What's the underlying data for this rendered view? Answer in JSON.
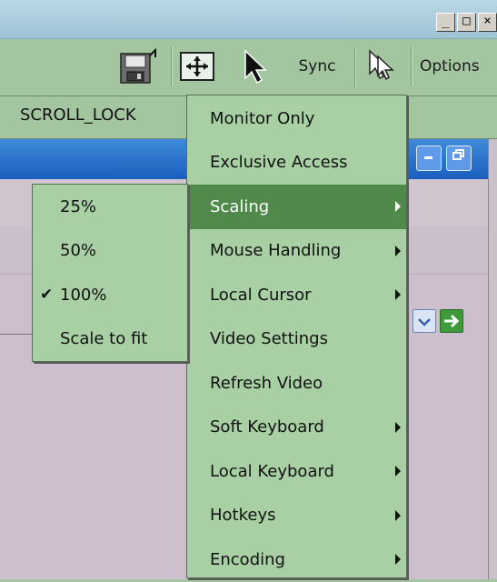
{
  "window": {
    "minimize_label": "_",
    "maximize_label": "□",
    "close_label": "×"
  },
  "toolbar": {
    "sync_label": "Sync",
    "options_label": "Options"
  },
  "status": {
    "scroll_lock": "SCROLL_LOCK"
  },
  "menu": {
    "items": [
      {
        "label": "Monitor Only",
        "has_submenu": false
      },
      {
        "label": "Exclusive Access",
        "has_submenu": false
      },
      {
        "label": "Scaling",
        "has_submenu": true,
        "active": true
      },
      {
        "label": "Mouse Handling",
        "has_submenu": true
      },
      {
        "label": "Local Cursor",
        "has_submenu": true
      },
      {
        "label": "Video Settings",
        "has_submenu": false
      },
      {
        "label": "Refresh Video",
        "has_submenu": false
      },
      {
        "label": "Soft Keyboard",
        "has_submenu": true
      },
      {
        "label": "Local Keyboard",
        "has_submenu": true
      },
      {
        "label": "Hotkeys",
        "has_submenu": true
      },
      {
        "label": "Encoding",
        "has_submenu": true
      }
    ]
  },
  "scaling_submenu": {
    "items": [
      {
        "label": "25%",
        "checked": false
      },
      {
        "label": "50%",
        "checked": false
      },
      {
        "label": "100%",
        "checked": true
      },
      {
        "label": "Scale to fit",
        "checked": false
      }
    ],
    "check_glyph": "✔"
  },
  "colors": {
    "menu_bg": "#a8d0a4",
    "menu_active": "#4f8a4a",
    "toolbar_bg": "#a3c6a0",
    "titlebar": "#b9d7e4"
  }
}
